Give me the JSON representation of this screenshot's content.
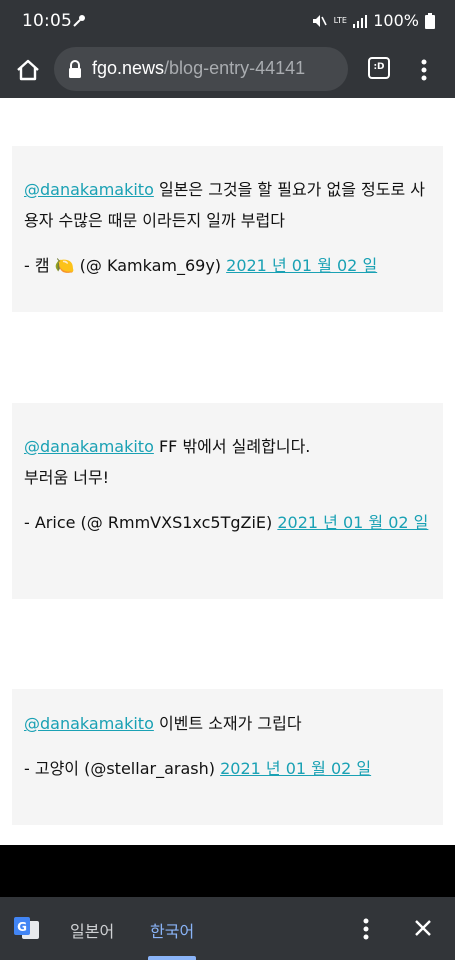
{
  "status_bar": {
    "time": "10:05",
    "battery": "100%",
    "network": "LTE"
  },
  "browser": {
    "url_domain": "fgo.news",
    "url_path": "/blog-entry-44141",
    "tabs_label": ":D"
  },
  "comments": [
    {
      "mention": "@danakamakito",
      "text": " 일본은 그것을 할 필요가 없을 정도로 사용자 수많은 때문 이라든지 일까 부럽다",
      "author": "- 캠 🍋 (@ Kamkam_69y) ",
      "date": "2021 년 01 월 02 일"
    },
    {
      "mention": "@danakamakito",
      "text_line1": " FF 밖에서 실례합니다.",
      "text_line2": "부러움 너무!",
      "author": "- Arice (@ RmmVXS1xc5TgZiE) ",
      "date": "2021 년 01 월 02 일"
    },
    {
      "mention": "@danakamakito",
      "text": " 이벤트 소재가 그립다",
      "author": "- 고양이 (@stellar_arash) ",
      "date": "2021 년 01 월 02 일"
    }
  ],
  "translate_bar": {
    "source_lang": "일본어",
    "target_lang": "한국어"
  },
  "colors": {
    "chrome_dark": "#323539",
    "link": "#1aa1b4",
    "active_tab": "#8ab4f8"
  }
}
